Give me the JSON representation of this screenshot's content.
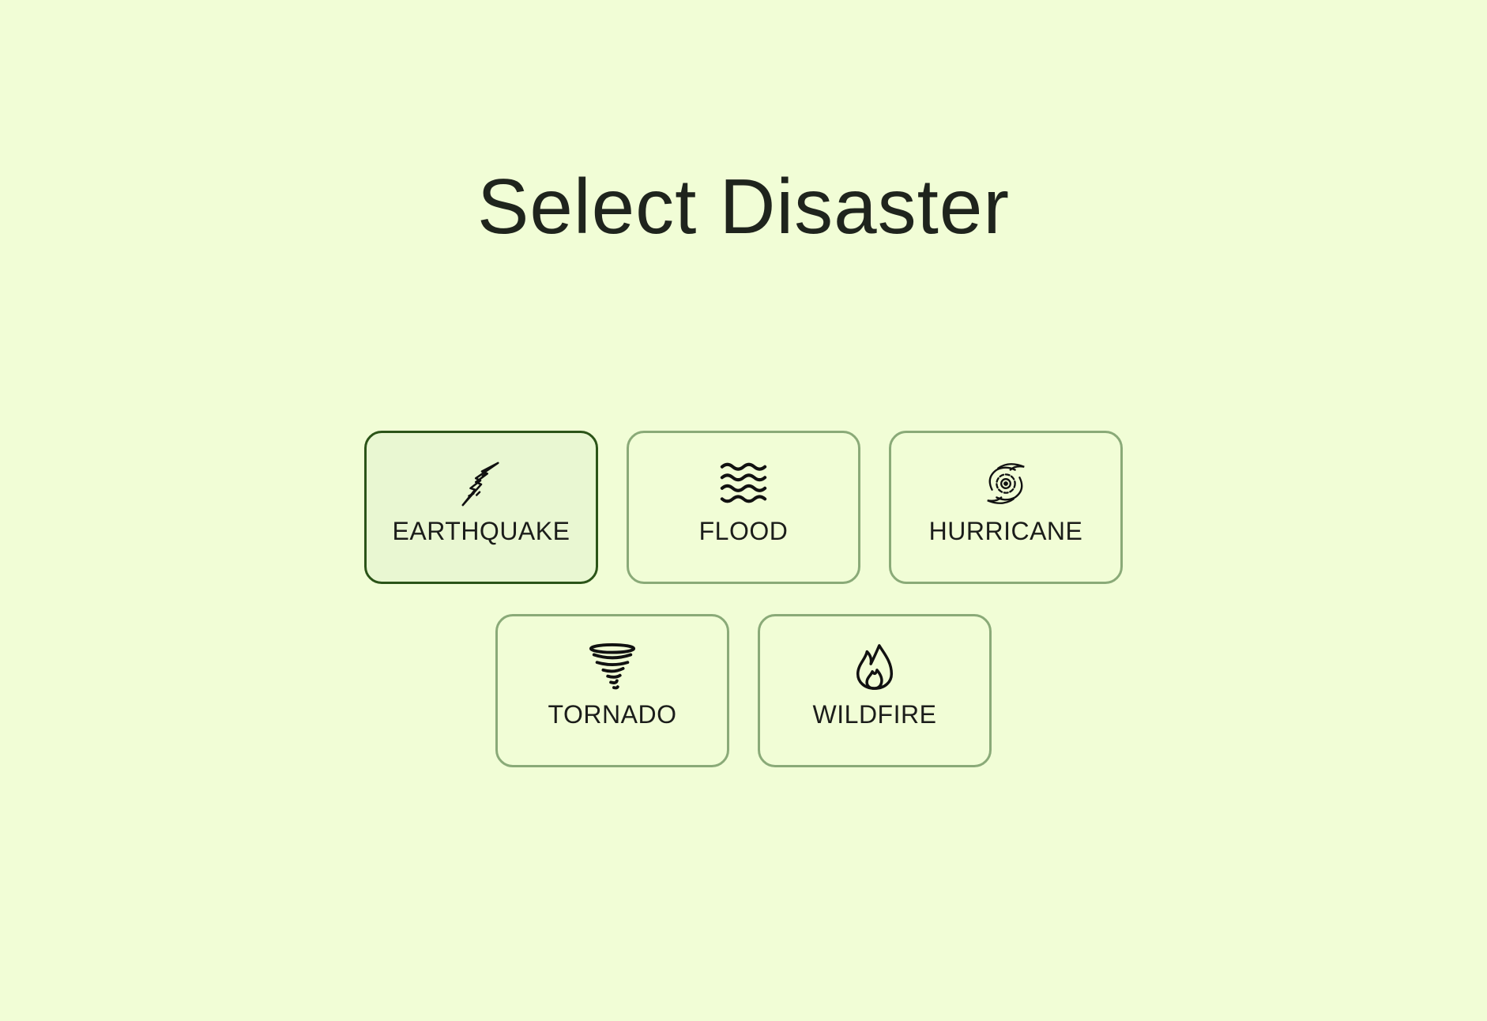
{
  "page": {
    "title": "Select Disaster"
  },
  "options": [
    {
      "label": "EARTHQUAKE",
      "icon": "earthquake-icon",
      "selected": true
    },
    {
      "label": "FLOOD",
      "icon": "flood-icon",
      "selected": false
    },
    {
      "label": "HURRICANE",
      "icon": "hurricane-icon",
      "selected": false
    },
    {
      "label": "TORNADO",
      "icon": "tornado-icon",
      "selected": false
    },
    {
      "label": "WILDFIRE",
      "icon": "wildfire-icon",
      "selected": false
    }
  ],
  "colors": {
    "background": "#f1fdd6",
    "card_border": "#8aaa78",
    "selected_border": "#2b5418",
    "selected_background": "#e9f7d2",
    "text": "#1f241d"
  }
}
